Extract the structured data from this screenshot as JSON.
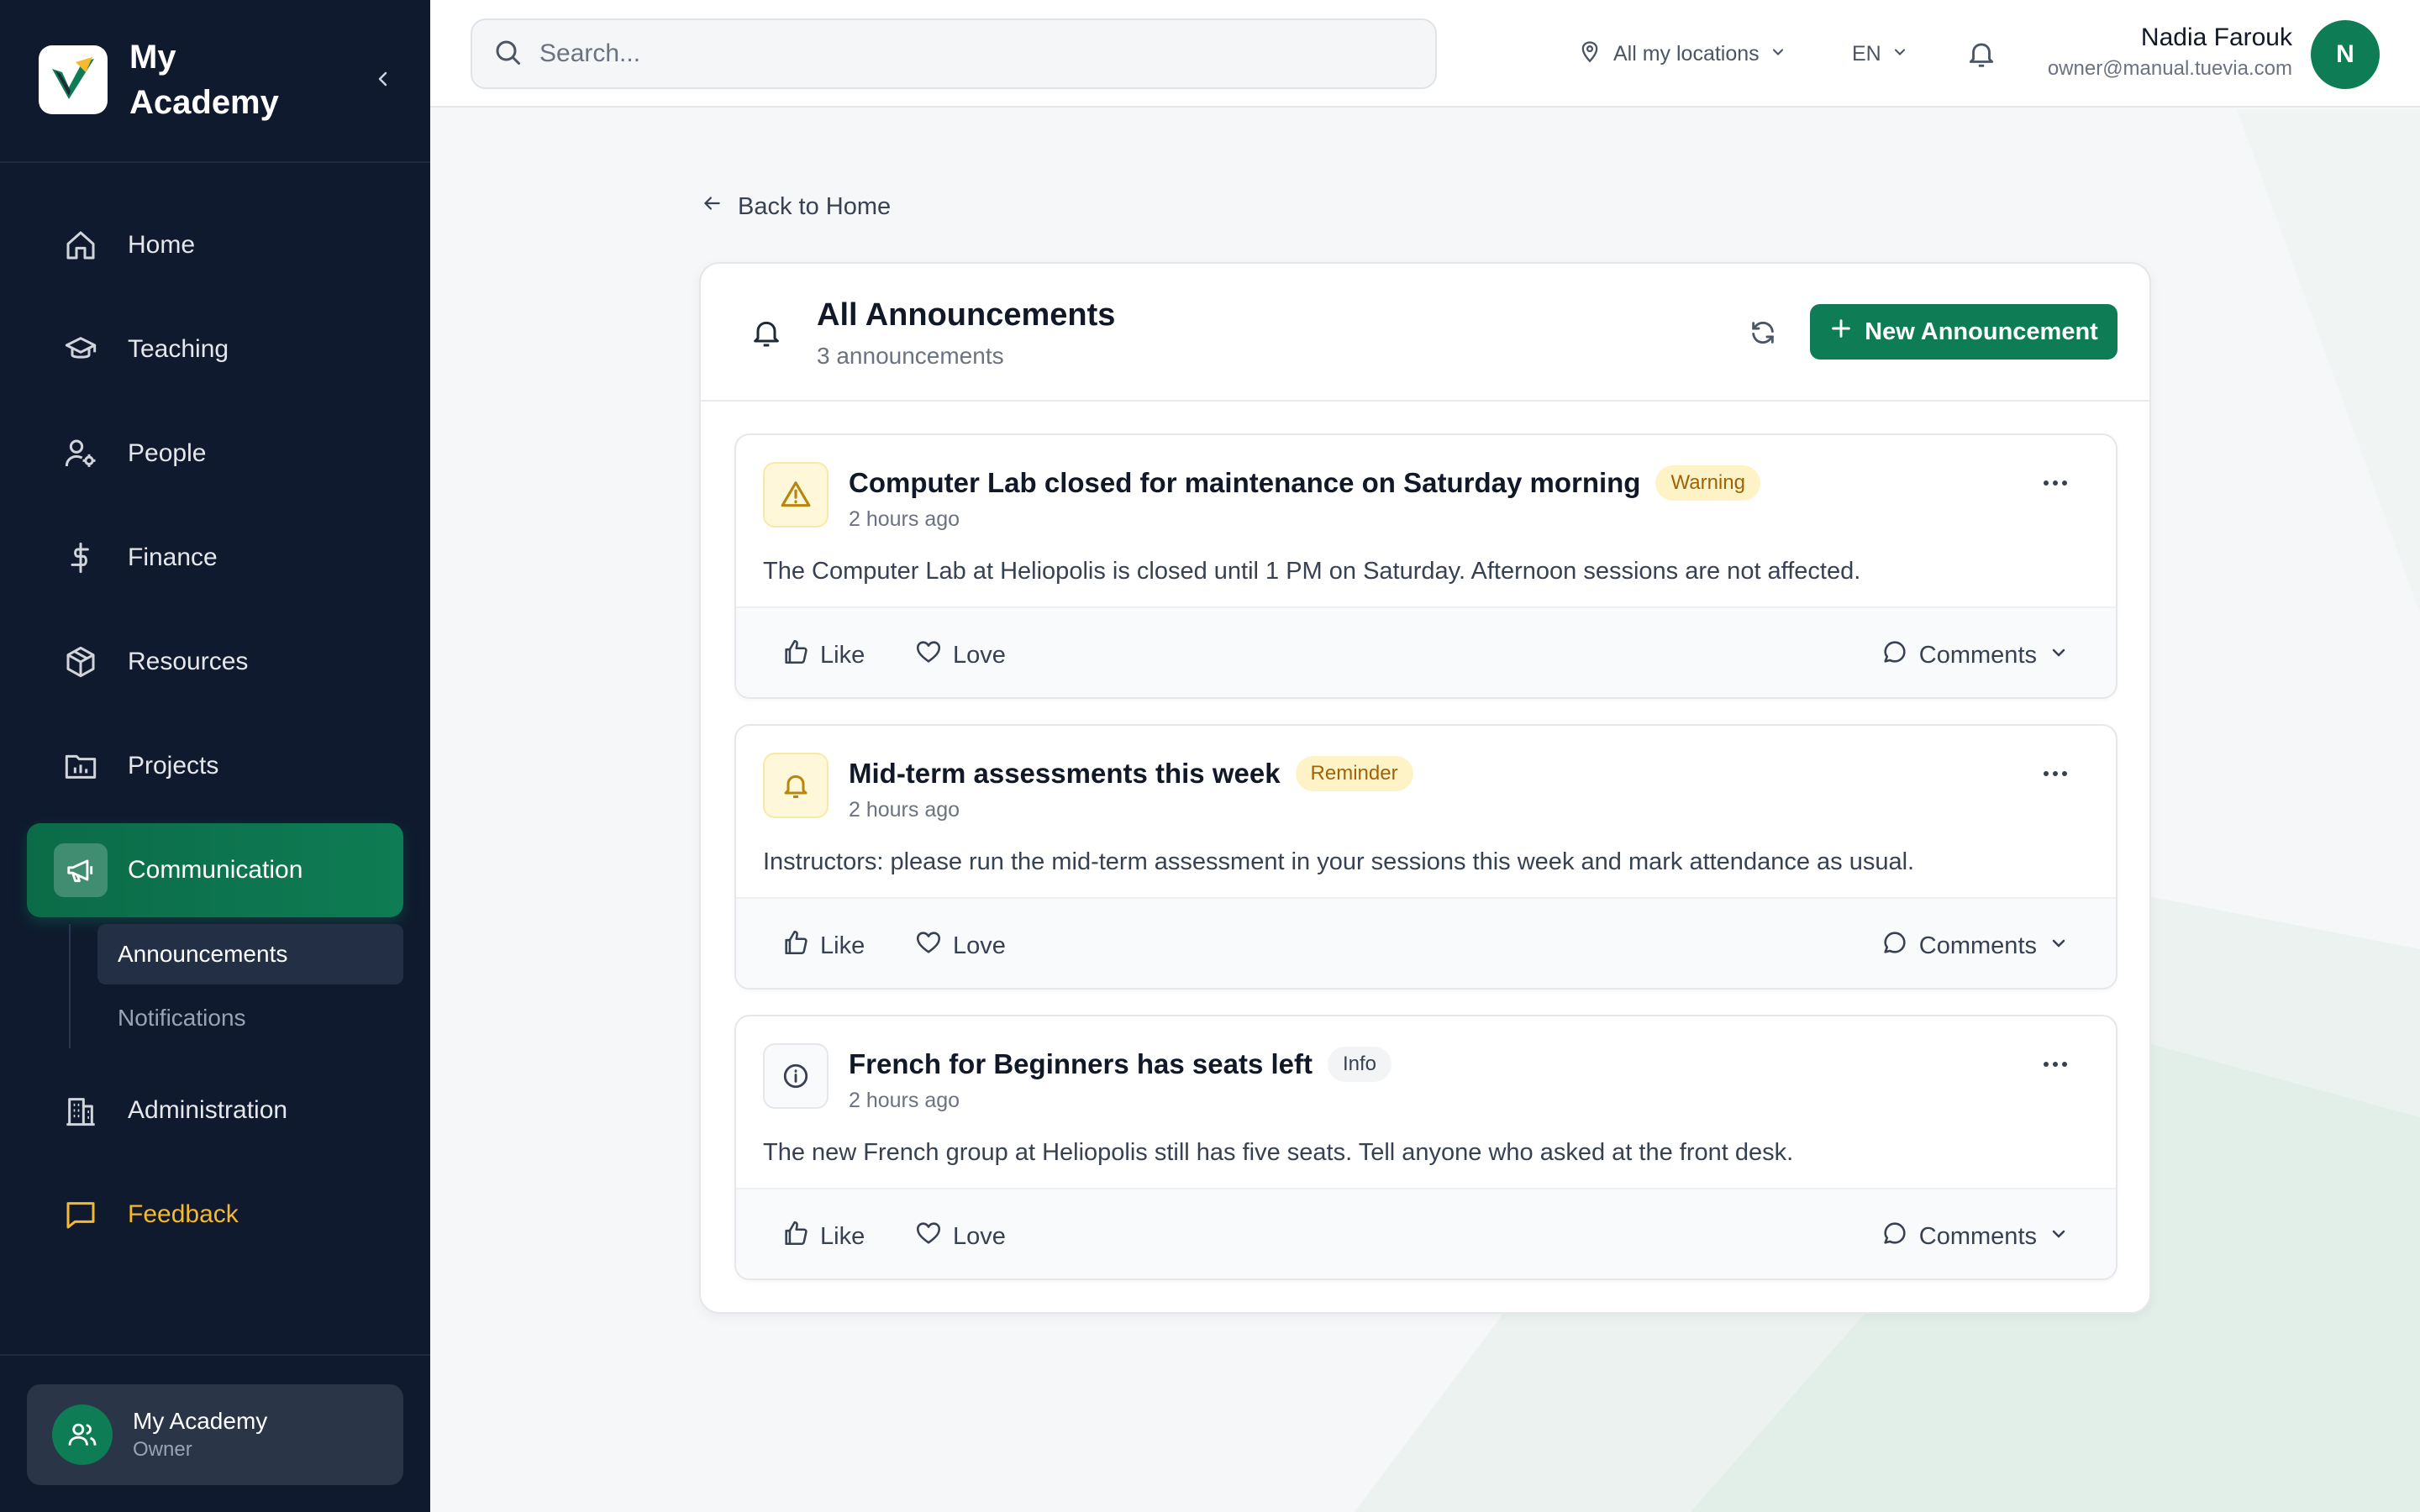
{
  "sidebar": {
    "brand": "My Academy",
    "nav": [
      {
        "label": "Home"
      },
      {
        "label": "Teaching"
      },
      {
        "label": "People"
      },
      {
        "label": "Finance"
      },
      {
        "label": "Resources"
      },
      {
        "label": "Projects"
      },
      {
        "label": "Communication"
      },
      {
        "label": "Administration"
      },
      {
        "label": "Feedback"
      }
    ],
    "subnav": [
      {
        "label": "Announcements"
      },
      {
        "label": "Notifications"
      }
    ],
    "account": {
      "name": "My Academy",
      "role": "Owner"
    }
  },
  "topbar": {
    "search_placeholder": "Search...",
    "location": "All my locations",
    "language": "EN",
    "user": {
      "name": "Nadia Farouk",
      "email": "owner@manual.tuevia.com",
      "initial": "N"
    }
  },
  "main": {
    "back_label": "Back to Home",
    "title": "All Announcements",
    "subtitle": "3 announcements",
    "new_button": "New Announcement",
    "announcements": [
      {
        "title": "Computer Lab closed for maintenance on Saturday morning",
        "badge": "Warning",
        "time": "2 hours ago",
        "body": "The Computer Lab at Heliopolis is closed until 1 PM on Saturday. Afternoon sessions are not affected.",
        "like": "Like",
        "love": "Love",
        "comments": "Comments"
      },
      {
        "title": "Mid-term assessments this week",
        "badge": "Reminder",
        "time": "2 hours ago",
        "body": "Instructors: please run the mid-term assessment in your sessions this week and mark attendance as usual.",
        "like": "Like",
        "love": "Love",
        "comments": "Comments"
      },
      {
        "title": "French for Beginners has seats left",
        "badge": "Info",
        "time": "2 hours ago",
        "body": "The new French group at Heliopolis still has five seats. Tell anyone who asked at the front desk.",
        "like": "Like",
        "love": "Love",
        "comments": "Comments"
      }
    ]
  },
  "colors": {
    "sidebar_bg": "#0f1a2e",
    "accent": "#0e7c54",
    "feedback": "#f5b82e",
    "badge_warning_bg": "#fdf3c6"
  }
}
